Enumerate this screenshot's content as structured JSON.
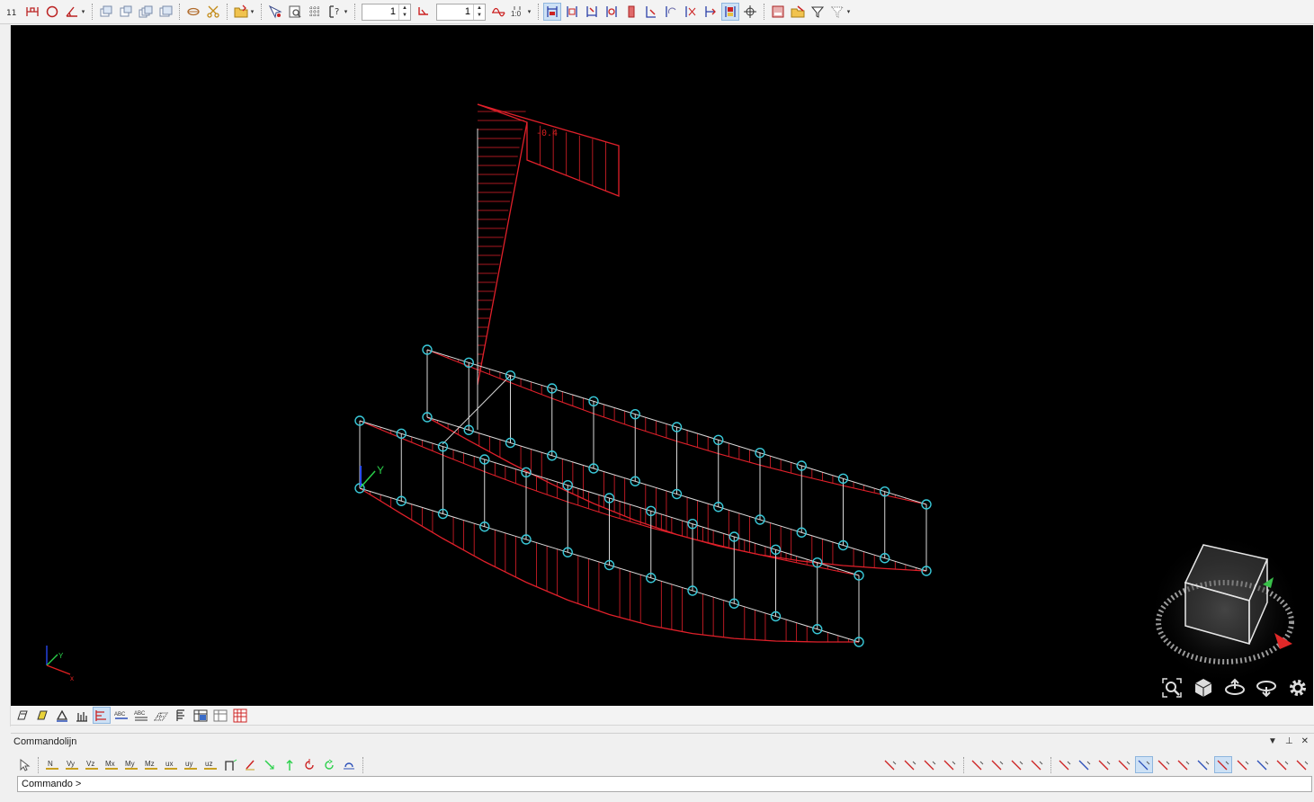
{
  "toolbar": {
    "spinner_1_value": "1",
    "spinner_2_value": "1",
    "tool_scale_label": "1:0"
  },
  "viewport": {
    "force_label": "-0.4",
    "axis_y_label": "Y",
    "triad_y_label": "Y",
    "triad_x_label": "x",
    "colors": {
      "background": "#000000",
      "diagram": "#e0202a",
      "node": "#39c8d8",
      "member": "#d8d8d8"
    }
  },
  "view_toolbar": {
    "abc_1": "ABC",
    "abc_2": "ABC"
  },
  "command": {
    "title": "Commandolijn",
    "prompt": "Commando >",
    "input_value": "",
    "tool_labels": [
      "N",
      "Vy",
      "Vz",
      "Mx",
      "My",
      "Mz",
      "ux",
      "uy",
      "uz"
    ]
  }
}
